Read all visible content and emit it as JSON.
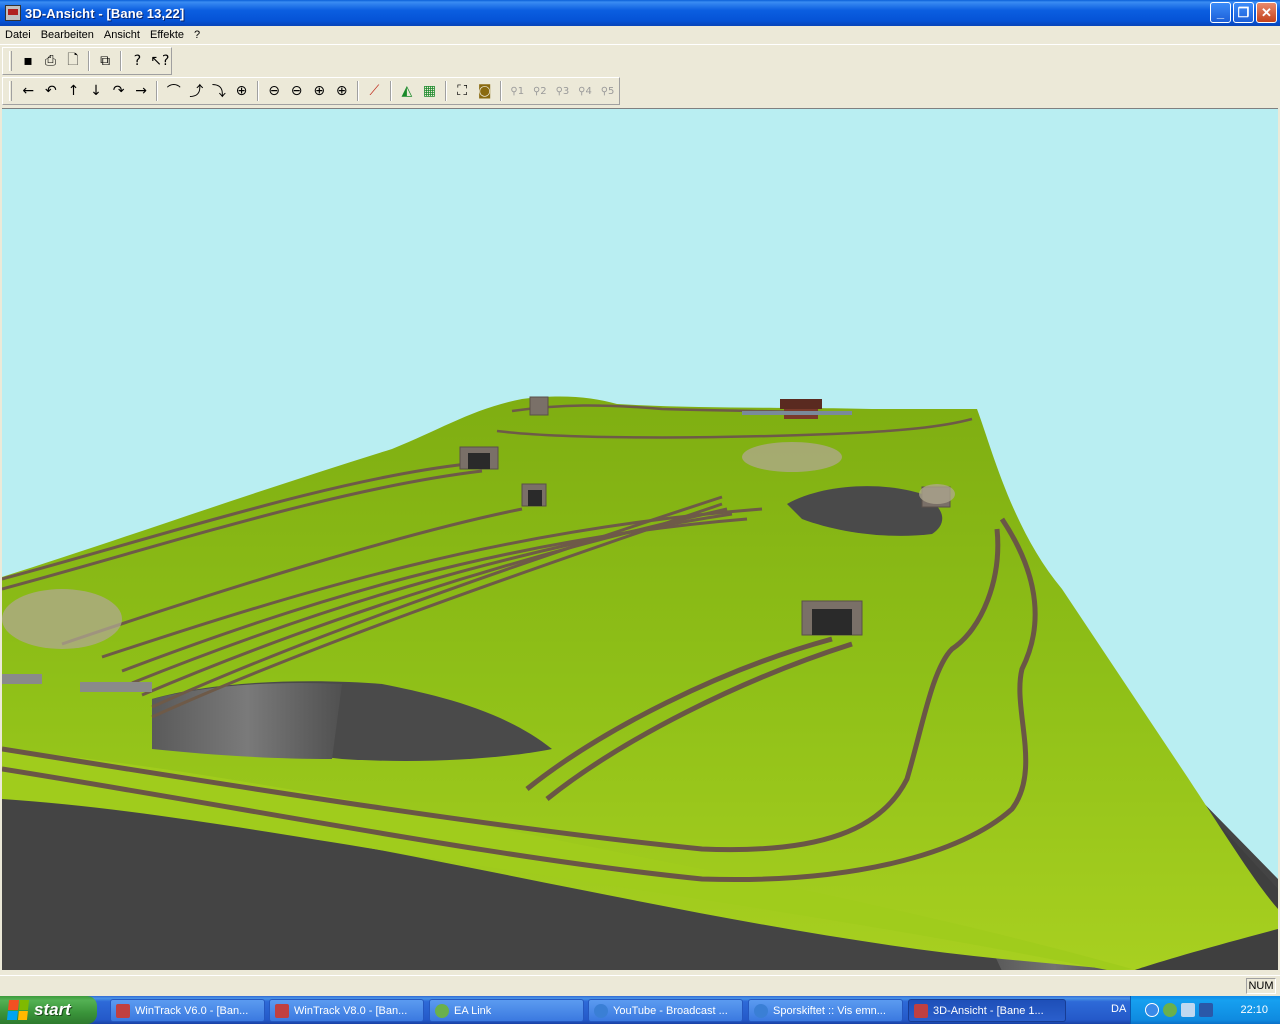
{
  "window": {
    "title": "3D-Ansicht - [Bane 13,22]"
  },
  "menu": [
    "Datei",
    "Bearbeiten",
    "Ansicht",
    "Effekte",
    "?"
  ],
  "toolbar1": [
    {
      "icon": "save-icon",
      "glyph": "▪"
    },
    {
      "icon": "print-icon",
      "glyph": "⎙"
    },
    {
      "icon": "print-preview-icon",
      "glyph": "🗋"
    },
    {
      "icon": "copy-icon",
      "glyph": "⧉"
    },
    {
      "icon": "help-icon",
      "glyph": "?"
    },
    {
      "icon": "context-help-icon",
      "glyph": "↖?"
    }
  ],
  "toolbar2": {
    "nav": [
      {
        "icon": "arrow-left-icon",
        "glyph": "←"
      },
      {
        "icon": "rotate-left-icon",
        "glyph": "↶"
      },
      {
        "icon": "arrow-up-icon",
        "glyph": "↑"
      },
      {
        "icon": "arrow-down-icon",
        "glyph": "↓"
      },
      {
        "icon": "rotate-right-icon",
        "glyph": "↷"
      },
      {
        "icon": "arrow-right-icon",
        "glyph": "→"
      }
    ],
    "view": [
      {
        "icon": "camera-tilt-up-icon",
        "glyph": "⌒"
      },
      {
        "icon": "camera-raise-icon",
        "glyph": "⤴"
      },
      {
        "icon": "camera-lower-icon",
        "glyph": "⤵"
      },
      {
        "icon": "camera-reset-icon",
        "glyph": "⊕"
      }
    ],
    "zoom": [
      {
        "icon": "zoom-out-fast-icon",
        "glyph": "⊖"
      },
      {
        "icon": "zoom-out-icon",
        "glyph": "⊖"
      },
      {
        "icon": "zoom-in-icon",
        "glyph": "⊕"
      },
      {
        "icon": "zoom-in-fast-icon",
        "glyph": "⊕"
      }
    ],
    "tools": [
      {
        "icon": "track-tool-icon",
        "glyph": "⟋"
      },
      {
        "icon": "landscape-icon",
        "glyph": "◭"
      },
      {
        "icon": "grid-icon",
        "glyph": "▦"
      },
      {
        "icon": "fit-view-icon",
        "glyph": "⛶"
      },
      {
        "icon": "camera-icon",
        "glyph": "◙"
      }
    ],
    "positions": [
      {
        "icon": "position-1-icon",
        "glyph": "⚲1"
      },
      {
        "icon": "position-2-icon",
        "glyph": "⚲2"
      },
      {
        "icon": "position-3-icon",
        "glyph": "⚲3"
      },
      {
        "icon": "position-4-icon",
        "glyph": "⚲4"
      },
      {
        "icon": "position-5-icon",
        "glyph": "⚲5"
      }
    ]
  },
  "status": {
    "num": "NUM"
  },
  "taskbar": {
    "start": "start",
    "tasks": [
      {
        "label": "WinTrack  V6.0 - [Ban...",
        "icon_color": "#c04040"
      },
      {
        "label": "WinTrack  V8.0 - [Ban...",
        "icon_color": "#c04040"
      },
      {
        "label": "EA Link",
        "icon_color": "#6ab04c"
      },
      {
        "label": "YouTube - Broadcast ...",
        "icon_color": "#3a7fd5"
      },
      {
        "label": "Sporskiftet :: Vis emn...",
        "icon_color": "#3a7fd5"
      },
      {
        "label": "3D-Ansicht - [Bane 1...",
        "icon_color": "#c04040"
      }
    ],
    "lang": "DA",
    "clock": "22:10"
  },
  "colors": {
    "sky": "#b9eef2",
    "terrain": "#8cbc14",
    "pit": "#4a4a4a",
    "track": "#6e5a48"
  }
}
